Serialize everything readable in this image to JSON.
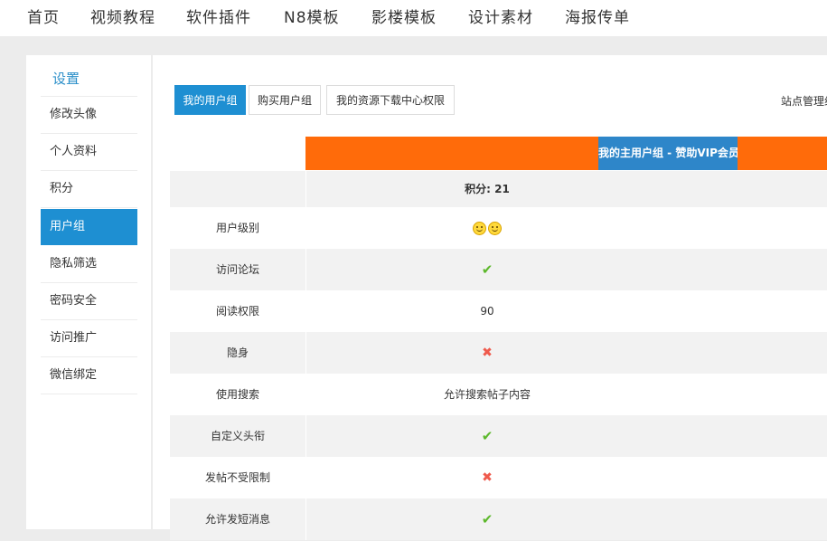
{
  "topnav": {
    "items": [
      "首页",
      "视频教程",
      "软件插件",
      "N8模板",
      "影楼模板",
      "设计素材",
      "海报传单"
    ]
  },
  "sidebar": {
    "title": "设置",
    "items": [
      {
        "label": "修改头像",
        "active": false
      },
      {
        "label": "个人资料",
        "active": false
      },
      {
        "label": "积分",
        "active": false
      },
      {
        "label": "用户组",
        "active": true
      },
      {
        "label": "隐私筛选",
        "active": false
      },
      {
        "label": "密码安全",
        "active": false
      },
      {
        "label": "访问推广",
        "active": false
      },
      {
        "label": "微信绑定",
        "active": false
      }
    ]
  },
  "tabs": [
    {
      "label": "我的用户组",
      "active": true
    },
    {
      "label": "购买用户组",
      "active": false
    },
    {
      "label": "我的资源下载中心权限",
      "active": false
    }
  ],
  "site_admin_label": "站点管理组",
  "table": {
    "group_header": "我的主用户组 - 赞助VIP会员",
    "points_text": "积分: 21",
    "rows": [
      {
        "label": "用户级别",
        "type": "icons",
        "icon": "smiley-icon",
        "count": 2
      },
      {
        "label": "访问论坛",
        "type": "check"
      },
      {
        "label": "阅读权限",
        "type": "text",
        "value": "90"
      },
      {
        "label": "隐身",
        "type": "cross"
      },
      {
        "label": "使用搜索",
        "type": "text",
        "value": "允许搜索帖子内容"
      },
      {
        "label": "自定义头衔",
        "type": "check"
      },
      {
        "label": "发帖不受限制",
        "type": "cross"
      },
      {
        "label": "允许发短消息",
        "type": "check"
      }
    ]
  },
  "colors": {
    "accent": "#1e8fd2",
    "header_orange": "#ff6b0a",
    "group_blue": "#2e86c9",
    "check_green": "#5cb82b",
    "cross_red": "#ef5a4c"
  }
}
